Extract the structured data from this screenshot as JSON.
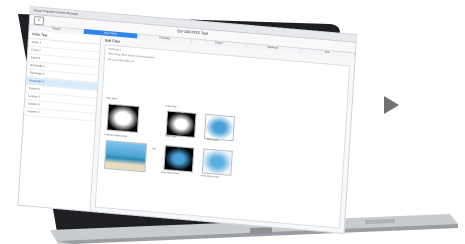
{
  "window": {
    "title": "Epson Projector Content Manager"
  },
  "header": {
    "back_label": "<",
    "app_title": "EV-100 POS Test",
    "tabs": [
      {
        "label": "Playlist",
        "active": false
      },
      {
        "label": "Filter Effect",
        "active": true
      },
      {
        "label": "Timetable",
        "active": false
      },
      {
        "label": "Export",
        "active": false
      },
      {
        "label": "Duplicate",
        "active": false
      },
      {
        "label": "New",
        "active": false
      }
    ]
  },
  "sidebar": {
    "title": "Filter Test",
    "items": [
      {
        "label": "Circle 1",
        "selected": false
      },
      {
        "label": "Circle 2",
        "selected": false
      },
      {
        "label": "Circle 3",
        "selected": false
      },
      {
        "label": "Rectangle 1",
        "selected": false
      },
      {
        "label": "Rectangle 2",
        "selected": false
      },
      {
        "label": "Rectangle 3",
        "selected": true
      },
      {
        "label": "Custom 1",
        "selected": false
      },
      {
        "label": "Custom 2",
        "selected": false
      },
      {
        "label": "Custom 3",
        "selected": false
      },
      {
        "label": "Custom 4",
        "selected": false
      }
    ]
  },
  "main": {
    "section_title": "Edit Filter",
    "description_lines": [
      "Rectangle 1",
      "Filter shape: Blurs around a frame projection",
      "Off: Leave filter effect off"
    ],
    "captions": {
      "filter_mask": "Filter Mask",
      "image_filter": "Image Filter",
      "projected_image": "Projected image sample",
      "result1": "Black Mask",
      "result2": "White Mask",
      "result3": "Black Mask (Invert)",
      "result4": "White Mask (Invert)"
    }
  },
  "colors": {
    "accent": "#2f86e8",
    "play_button": "#707070"
  }
}
